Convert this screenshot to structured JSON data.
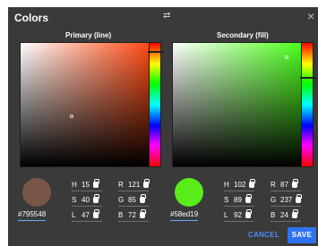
{
  "dialog": {
    "title": "Colors",
    "swap_icon": "swap-icon",
    "close_icon": "close-icon"
  },
  "primary": {
    "label": "Primary (line)",
    "hex": "#795548",
    "color": "#795548",
    "hsl": [
      {
        "key": "H",
        "value": "15"
      },
      {
        "key": "S",
        "value": "40"
      },
      {
        "key": "L",
        "value": "47"
      }
    ],
    "rgb": [
      {
        "key": "R",
        "value": "121"
      },
      {
        "key": "G",
        "value": "85"
      },
      {
        "key": "B",
        "value": "72"
      }
    ]
  },
  "secondary": {
    "label": "Secondary (fill)",
    "hex": "#58ed19",
    "color": "#58ed19",
    "hsl": [
      {
        "key": "H",
        "value": "102"
      },
      {
        "key": "S",
        "value": "89"
      },
      {
        "key": "L",
        "value": "92"
      }
    ],
    "rgb": [
      {
        "key": "R",
        "value": "87"
      },
      {
        "key": "G",
        "value": "237"
      },
      {
        "key": "B",
        "value": "24"
      }
    ]
  },
  "buttons": {
    "cancel": "CANCEL",
    "save": "SAVE"
  },
  "colors": {
    "background": "#3a3a3a",
    "accent": "#2f73f0"
  }
}
